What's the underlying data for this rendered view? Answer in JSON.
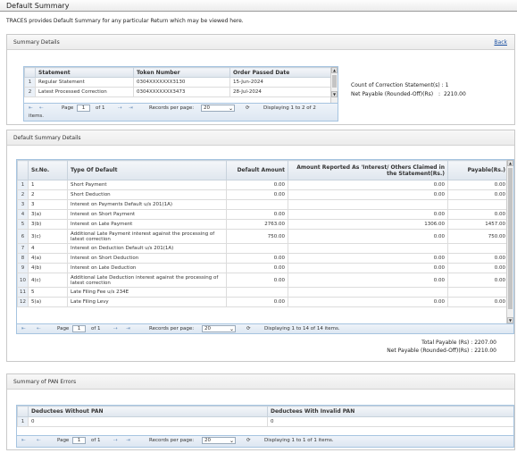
{
  "page": {
    "title": "Default Summary",
    "intro": "TRACES provides Default Summary for any particular Return which may be viewed here."
  },
  "summary_details": {
    "header": "Summary Details",
    "back": "Back",
    "columns": [
      "Statement",
      "Token Number",
      "Order Passed Date"
    ],
    "rows": [
      {
        "n": "1",
        "statement": "Regular Statement",
        "token": "0304XXXXXXX3130",
        "date": "15-Jun-2024"
      },
      {
        "n": "2",
        "statement": "Latest Processed Correction",
        "token": "0304XXXXXXX3473",
        "date": "28-Jul-2024"
      }
    ],
    "pager": {
      "first": "⇤",
      "prev": "⇠",
      "page_label": "Page",
      "page": "1",
      "of": "of 1",
      "next": "⇢",
      "last": "⇥",
      "rpp_label": "Records per page:",
      "rpp": "20",
      "refresh": "⟳",
      "display": "Displaying 1 to 2 of 2",
      "display2": "items."
    },
    "count_label": "Count of Correction Statement(s) :",
    "count_value": "1",
    "net_label": "Net Payable (Rounded-Off)(Rs)",
    "net_sep": ":",
    "net_value": "2210.00"
  },
  "default_summary": {
    "header": "Default Summary Details",
    "columns": [
      "Sr.No.",
      "Type Of Default",
      "Default Amount",
      "Amount Reported As 'Interest/ Others Claimed in the Statement(Rs.)",
      "Payable(Rs.)"
    ],
    "rows": [
      {
        "n": "1",
        "sr": "1",
        "type": "Short Payment",
        "amt": "0.00",
        "rep": "0.00",
        "pay": "0.00"
      },
      {
        "n": "2",
        "sr": "2",
        "type": "Short Deduction",
        "amt": "0.00",
        "rep": "0.00",
        "pay": "0.00"
      },
      {
        "n": "3",
        "sr": "3",
        "type": "Interest on Payments Default u/s 201(1A)",
        "amt": "",
        "rep": "",
        "pay": ""
      },
      {
        "n": "4",
        "sr": "3(a)",
        "type": "Interest on Short Payment",
        "amt": "0.00",
        "rep": "0.00",
        "pay": "0.00"
      },
      {
        "n": "5",
        "sr": "3(b)",
        "type": "Interest on Late Payment",
        "amt": "2763.00",
        "rep": "1306.00",
        "pay": "1457.00"
      },
      {
        "n": "6",
        "sr": "3(c)",
        "type": "Additional Late Payment interest against the processing of latest correction",
        "amt": "750.00",
        "rep": "0.00",
        "pay": "750.00"
      },
      {
        "n": "7",
        "sr": "4",
        "type": "Interest on Deduction Default u/s 201(1A)",
        "amt": "",
        "rep": "",
        "pay": ""
      },
      {
        "n": "8",
        "sr": "4(a)",
        "type": "Interest on Short Deduction",
        "amt": "0.00",
        "rep": "0.00",
        "pay": "0.00"
      },
      {
        "n": "9",
        "sr": "4(b)",
        "type": "Interest on Late Deduction",
        "amt": "0.00",
        "rep": "0.00",
        "pay": "0.00"
      },
      {
        "n": "10",
        "sr": "4(c)",
        "type": "Additional Late Deduction interest against the processing of latest correction",
        "amt": "0.00",
        "rep": "0.00",
        "pay": "0.00"
      },
      {
        "n": "11",
        "sr": "5",
        "type": "Late Filing Fee u/s 234E",
        "amt": "",
        "rep": "",
        "pay": ""
      },
      {
        "n": "12",
        "sr": "5(a)",
        "type": "Late Filing Levy",
        "amt": "0.00",
        "rep": "0.00",
        "pay": "0.00"
      }
    ],
    "pager": {
      "first": "⇤",
      "prev": "⇠",
      "page_label": "Page",
      "page": "1",
      "of": "of 1",
      "next": "⇢",
      "last": "⇥",
      "rpp_label": "Records per page:",
      "rpp": "20",
      "refresh": "⟳",
      "display": "Displaying 1 to 14 of 14 items."
    },
    "total_label": "Total Payable (Rs) :",
    "total_value": "2207.00",
    "net_label": "Net Payable (Rounded-Off)(Rs) :",
    "net_value": "2210.00"
  },
  "pan_errors": {
    "header": "Summary of PAN Errors",
    "columns": [
      "Deductees Without PAN",
      "Deductees With Invalid PAN"
    ],
    "rows": [
      {
        "n": "1",
        "without": "0",
        "invalid": "0"
      }
    ],
    "pager": {
      "first": "⇤",
      "prev": "⇠",
      "page_label": "Page",
      "page": "1",
      "of": "of 1",
      "next": "⇢",
      "last": "⇥",
      "rpp_label": "Records per page:",
      "rpp": "20",
      "refresh": "⟳",
      "display": "Displaying 1 to 1 of 1 items."
    }
  }
}
